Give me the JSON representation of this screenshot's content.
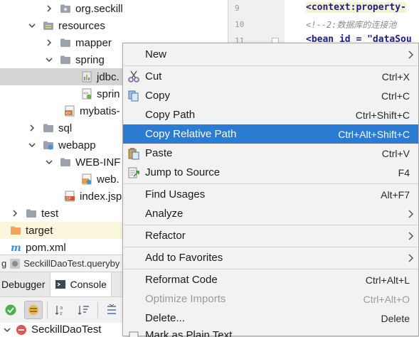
{
  "tree": {
    "items": [
      {
        "label": "org.seckill",
        "icon": "package-icon"
      },
      {
        "label": "resources",
        "icon": "resources-folder-icon"
      },
      {
        "label": "mapper",
        "icon": "folder-icon"
      },
      {
        "label": "spring",
        "icon": "folder-icon"
      },
      {
        "label": "jdbc.",
        "icon": "properties-file-icon"
      },
      {
        "label": "sprin",
        "icon": "spring-xml-icon"
      },
      {
        "label": "mybatis-",
        "icon": "xml-file-icon"
      },
      {
        "label": "sql",
        "icon": "folder-icon"
      },
      {
        "label": "webapp",
        "icon": "web-folder-icon"
      },
      {
        "label": "WEB-INF",
        "icon": "folder-icon"
      },
      {
        "label": "web.",
        "icon": "web-xml-icon"
      },
      {
        "label": "index.jsp",
        "icon": "jsp-file-icon"
      },
      {
        "label": "test",
        "icon": "folder-icon"
      },
      {
        "label": "target",
        "icon": "orange-folder-icon"
      },
      {
        "label": "pom.xml",
        "icon": "maven-icon"
      }
    ]
  },
  "editor": {
    "line_numbers": [
      "9",
      "10",
      "11"
    ],
    "lines": [
      "<context:property-",
      "<!--2:数据库的连接池",
      "<bean id = \"dataSou"
    ]
  },
  "run_tab": {
    "label": "SeckillDaoTest.queryby"
  },
  "debug_tabs": {
    "debugger": "Debugger",
    "console": "Console"
  },
  "test_row": {
    "label": "SeckillDaoTest"
  },
  "menu": {
    "items": [
      {
        "label": "New",
        "shortcut": "",
        "submenu": true
      },
      {
        "label": "Cut",
        "shortcut": "Ctrl+X",
        "icon": "scissors-icon"
      },
      {
        "label": "Copy",
        "shortcut": "Ctrl+C",
        "icon": "copy-icon"
      },
      {
        "label": "Copy Path",
        "shortcut": "Ctrl+Shift+C"
      },
      {
        "label": "Copy Relative Path",
        "shortcut": "Ctrl+Alt+Shift+C"
      },
      {
        "label": "Paste",
        "shortcut": "Ctrl+V",
        "icon": "paste-icon"
      },
      {
        "label": "Jump to Source",
        "shortcut": "F4",
        "icon": "jump-to-source-icon"
      },
      {
        "label": "Find Usages",
        "shortcut": "Alt+F7"
      },
      {
        "label": "Analyze",
        "shortcut": "",
        "submenu": true
      },
      {
        "label": "Refactor",
        "shortcut": "",
        "submenu": true
      },
      {
        "label": "Add to Favorites",
        "shortcut": "",
        "submenu": true
      },
      {
        "label": "Reformat Code",
        "shortcut": "Ctrl+Alt+L"
      },
      {
        "label": "Optimize Imports",
        "shortcut": "Ctrl+Alt+O"
      },
      {
        "label": "Delete...",
        "shortcut": "Delete"
      },
      {
        "label": "Mark as Plain Text",
        "shortcut": ""
      }
    ]
  },
  "colors": {
    "highlight": "#2a7bd1",
    "menu_bg": "#f2f2f2",
    "selected_row": "#d5d5d5"
  }
}
